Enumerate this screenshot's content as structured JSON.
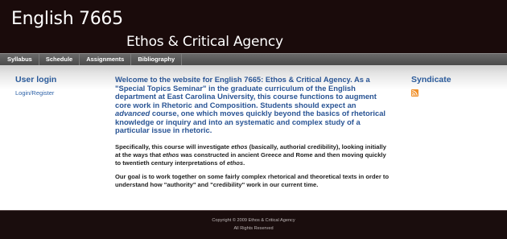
{
  "header": {
    "site_name": "English 7665",
    "slogan": "Ethos & Critical Agency"
  },
  "nav": {
    "items": [
      {
        "label": "Syllabus"
      },
      {
        "label": "Schedule"
      },
      {
        "label": "Assignments"
      },
      {
        "label": "Bibliography"
      }
    ]
  },
  "left_sidebar": {
    "title": "User login",
    "login_link": "Login/Register"
  },
  "content": {
    "intro": {
      "before_em": "Welcome to the website for English 7665: Ethos & Critical Agency. As a \"Special Topics Seminar\" in the graduate curriculum of the English department at East Carolina University, this course functions to augment core work in Rhetoric and Composition. Students should expect an ",
      "em": "advanced",
      "after_em": " course, one which moves quickly beyond the basics of rhetorical knowledge or inquiry and into an systematic and complex study of a particular issue in rhetoric."
    },
    "para1": {
      "part1": "Specifically, this course will investigate ",
      "em1": "ethos",
      "part2": " (basically, authorial credibility), looking initially at the ways that ",
      "em2": "ethos",
      "part3": " was constructed in ancient Greece and Rome and then moving quickly to twentieth century interpretations of ",
      "em3": "ethos",
      "part4": "."
    },
    "para2": "Our goal is to work together on some fairly complex rhetorical and theoretical texts in order to understand how \"authority\" and \"credibility\" work in our current time."
  },
  "right_sidebar": {
    "title": "Syndicate",
    "icon": "rss-feed-icon"
  },
  "footer": {
    "copyright": "Copyright © 2009 Ethos & Critical Agency",
    "rights": "All Rights Reserved"
  },
  "colors": {
    "header_bg": "#1a0b0b",
    "accent_blue": "#2a5595",
    "rss_orange": "#f0902a"
  }
}
